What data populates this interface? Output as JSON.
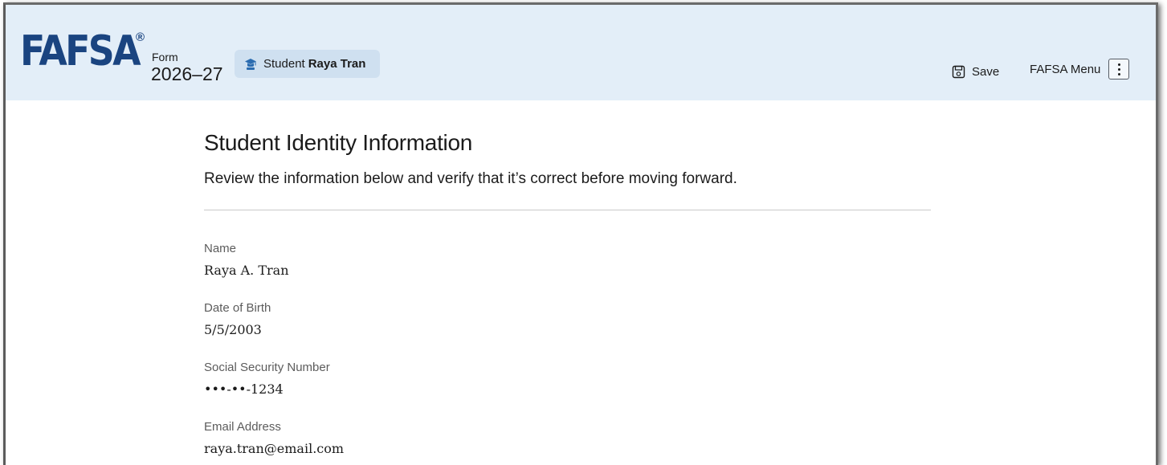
{
  "header": {
    "logo": "FAFSA",
    "logo_reg": "®",
    "form_label": "Form",
    "form_year": "2026–27",
    "student_prefix": "Student",
    "student_name": "Raya Tran",
    "save_label": "Save",
    "menu_label": "FAFSA Menu",
    "icons": {
      "student": "graduation-cap-icon",
      "save": "floppy-disk-icon",
      "menu": "kebab-menu-icon"
    },
    "colors": {
      "header_bg": "#e3eef8",
      "logo": "#1a4480",
      "pill_bg": "#cfe0f0"
    }
  },
  "main": {
    "title": "Student Identity Information",
    "subtitle": "Review the information below and verify that it’s correct before moving forward.",
    "fields": [
      {
        "label": "Name",
        "value": "Raya A. Tran"
      },
      {
        "label": "Date of Birth",
        "value": "5/5/2003"
      },
      {
        "label": "Social Security Number",
        "value": "•••-••-1234"
      },
      {
        "label": "Email Address",
        "value": "raya.tran@email.com"
      }
    ]
  }
}
